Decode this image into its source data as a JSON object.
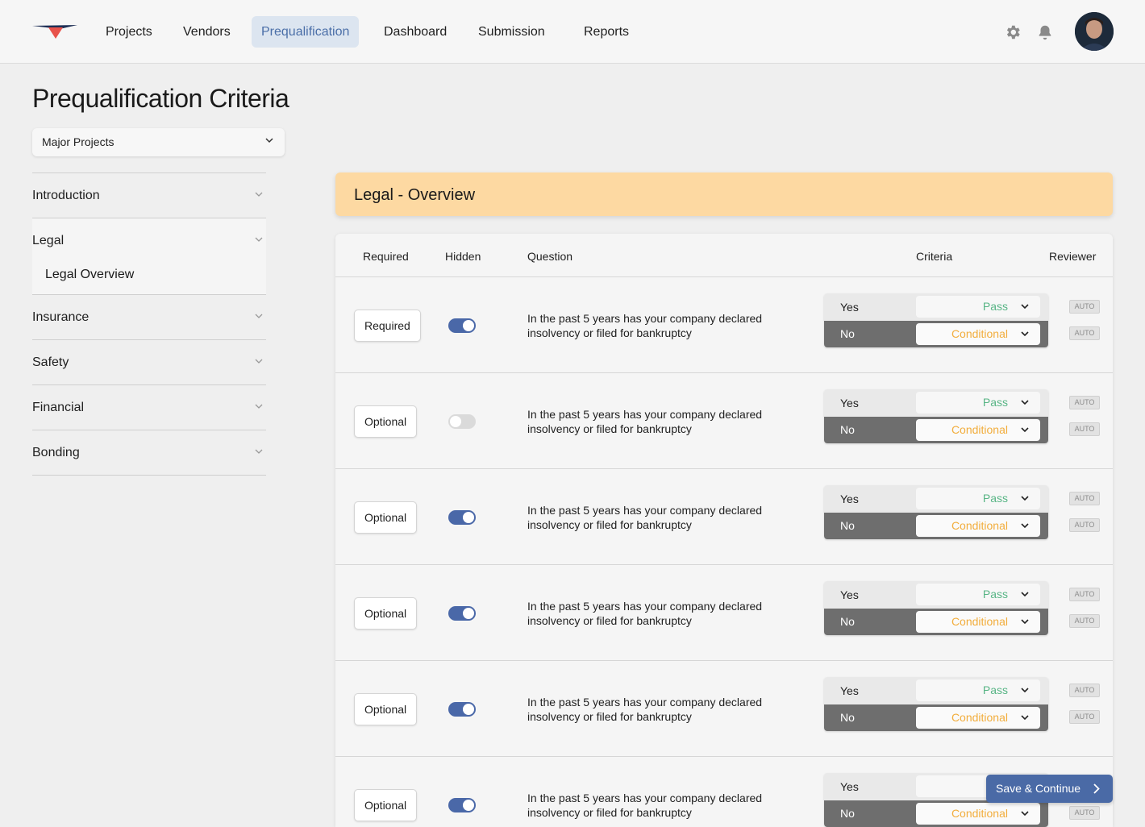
{
  "nav": {
    "items": [
      "Projects",
      "Vendors",
      "Prequalification",
      "Dashboard",
      "Submission",
      "Reports"
    ],
    "active": "Prequalification",
    "brand_colors": {
      "red": "#e8524a",
      "navy": "#1e2f55",
      "accent": "#4a6aa6"
    },
    "icons": [
      "settings-gear-icon",
      "notification-bell-icon"
    ]
  },
  "page": {
    "title": "Prequalification Criteria",
    "project_select": "Major Projects"
  },
  "sidebar": {
    "sections": [
      {
        "label": "Introduction"
      },
      {
        "label": "Legal",
        "sub": "Legal Overview"
      },
      {
        "label": "Insurance"
      },
      {
        "label": "Safety"
      },
      {
        "label": "Financial"
      },
      {
        "label": "Bonding"
      }
    ]
  },
  "banner": {
    "title": "Legal - Overview",
    "color": "#fdd9a2"
  },
  "table": {
    "headers": {
      "required": "Required",
      "hidden": "Hidden",
      "question": "Question",
      "criteria": "Criteria",
      "reviewer": "Reviewer"
    },
    "rows": [
      {
        "requirement": "Required",
        "hidden": true,
        "question": "In the past 5 years has your company declared insolvency or filed for bankruptcy",
        "yes_label": "Yes",
        "yes_value": "Pass",
        "no_label": "No",
        "no_value": "Conditional",
        "reviewer_yes": "AUTO",
        "reviewer_no": "AUTO"
      },
      {
        "requirement": "Optional",
        "hidden": false,
        "question": "In the past 5 years has your company declared insolvency or filed for bankruptcy",
        "yes_label": "Yes",
        "yes_value": "Pass",
        "no_label": "No",
        "no_value": "Conditional",
        "reviewer_yes": "AUTO",
        "reviewer_no": "AUTO"
      },
      {
        "requirement": "Optional",
        "hidden": true,
        "question": "In the past 5 years has your company declared insolvency or filed for bankruptcy",
        "yes_label": "Yes",
        "yes_value": "Pass",
        "no_label": "No",
        "no_value": "Conditional",
        "reviewer_yes": "AUTO",
        "reviewer_no": "AUTO"
      },
      {
        "requirement": "Optional",
        "hidden": true,
        "question": "In the past 5 years has your company declared insolvency or filed for bankruptcy",
        "yes_label": "Yes",
        "yes_value": "Pass",
        "no_label": "No",
        "no_value": "Conditional",
        "reviewer_yes": "AUTO",
        "reviewer_no": "AUTO"
      },
      {
        "requirement": "Optional",
        "hidden": true,
        "question": "In the past 5 years has your company declared insolvency or filed for bankruptcy",
        "yes_label": "Yes",
        "yes_value": "Pass",
        "no_label": "No",
        "no_value": "Conditional",
        "reviewer_yes": "AUTO",
        "reviewer_no": "AUTO"
      },
      {
        "requirement": "Optional",
        "hidden": true,
        "question": "In the past 5 years has your company declared insolvency or filed for bankruptcy",
        "yes_label": "Yes",
        "yes_value": "",
        "no_label": "No",
        "no_value": "Conditional",
        "reviewer_yes": "",
        "reviewer_no": "AUTO"
      }
    ]
  },
  "save_button": "Save & Continue"
}
